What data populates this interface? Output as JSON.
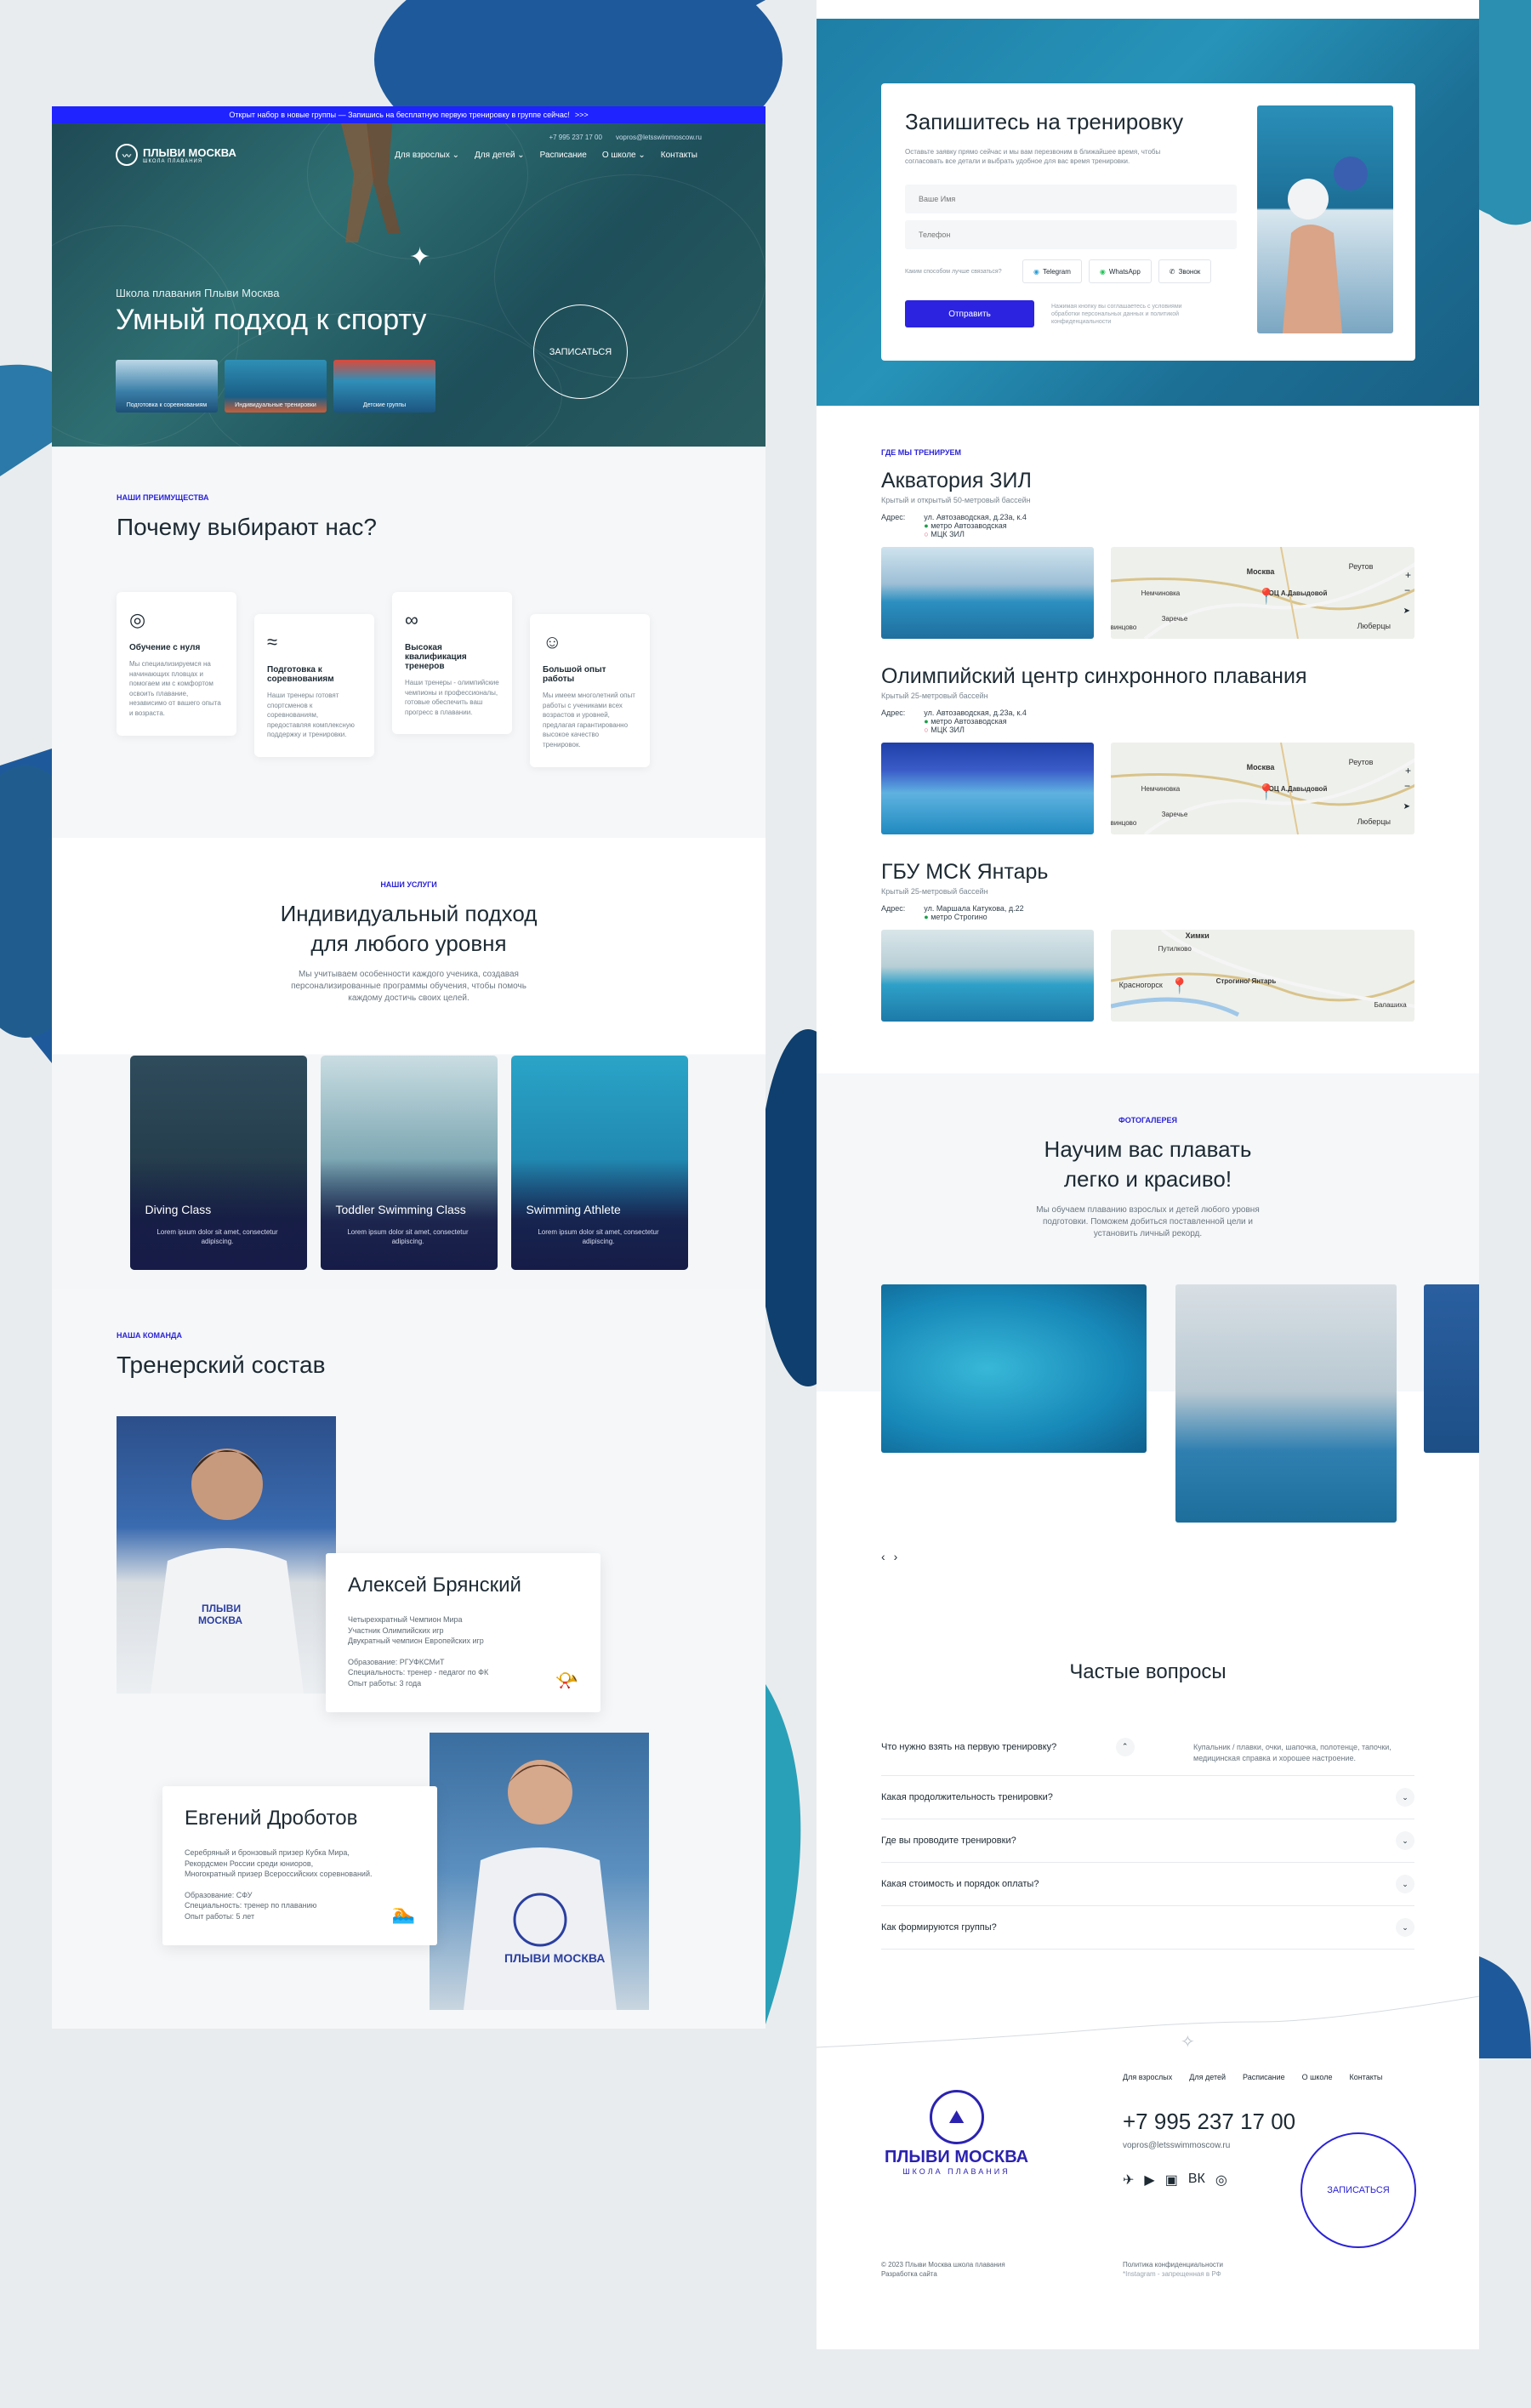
{
  "announce": {
    "text": "Открыт набор в новые группы — Запишись на бесплатную первую тренировку в группе сейчас!",
    "arrow": ">>>"
  },
  "brand": {
    "name": "ПЛЫВИ МОСКВА",
    "sub": "ШКОЛА ПЛАВАНИЯ",
    "accent": "#2b23d6"
  },
  "nav": {
    "items": [
      "Для взрослых",
      "Для детей",
      "Расписание",
      "О школе",
      "Контакты"
    ],
    "phone": "+7 995 237 17 00",
    "email": "vopros@letsswimmoscow.ru"
  },
  "hero": {
    "subtitle": "Школа плавания Плыви Москва",
    "title": "Умный подход к спорту",
    "cta": "ЗАПИСАТЬСЯ",
    "thumbs": [
      "Подготовка к соревнованиям",
      "Индивидуальные тренировки",
      "Детские группы"
    ]
  },
  "adv": {
    "eyebrow": "НАШИ ПРЕИМУЩЕСТВА",
    "title": "Почему выбирают нас?",
    "cards": [
      {
        "title": "Обучение с нуля",
        "text": "Мы специализируемся на начинающих пловцах и помогаем им с комфортом освоить плавание, независимо от вашего опыта и возраста.",
        "icon": "swim-goggles-icon"
      },
      {
        "title": "Подготовка к соревнованиям",
        "text": "Наши тренеры готовят спортсменов к соревнованиям, предоставляя комплексную поддержку и тренировки.",
        "icon": "swimmer-icon"
      },
      {
        "title": "Высокая квалификация тренеров",
        "text": "Наши тренеры - олимпийские чемпионы и профессионалы, готовые обеспечить ваш прогресс в плавании.",
        "icon": "olympic-rings-icon"
      },
      {
        "title": "Большой опыт работы",
        "text": "Мы имеем многолетний опыт работы с учениками всех возрастов и уровней, предлагая гарантированно высокое качество тренировок.",
        "icon": "team-icon"
      }
    ]
  },
  "svc": {
    "eyebrow": "НАШИ УСЛУГИ",
    "title1": "Индивидуальный подход",
    "title2": "для любого уровня",
    "desc": "Мы учитываем особенности каждого ученика, создавая персонализированные программы обучения, чтобы помочь каждому достичь своих целей.",
    "cards": [
      {
        "title": "Diving Class",
        "text": "Lorem ipsum dolor sit amet, consectetur adipiscing."
      },
      {
        "title": "Toddler Swimming Class",
        "text": "Lorem ipsum dolor sit amet, consectetur adipiscing."
      },
      {
        "title": "Swimming Athlete",
        "text": "Lorem ipsum dolor sit amet, consectetur adipiscing."
      }
    ]
  },
  "team": {
    "eyebrow": "НАША КОМАНДА",
    "title": "Тренерский состав",
    "coaches": [
      {
        "name": "Алексей Брянский",
        "l1": "Четырехкратный Чемпион Мира",
        "l2": "Участник Олимпийских игр",
        "l3": "Двукратный чемпион Европейских игр",
        "edu": "Образование: РГУФКСМиТ",
        "spec": "Специальность: тренер - педагог по ФК",
        "exp": "Опыт работы: 3 года"
      },
      {
        "name": "Евгений Дроботов",
        "l1": "Серебряный и бронзовый призер Кубка Мира,",
        "l2": "Рекордсмен России среди юниоров,",
        "l3": "Многократный призер Всероссийских соревнований.",
        "edu": "Образование: СФУ",
        "spec": "Специальность: тренер по плаванию",
        "exp": "Опыт работы: 5 лет"
      }
    ]
  },
  "signup": {
    "title": "Запишитесь на тренировку",
    "desc": "Оставьте заявку прямо сейчас и мы вам перезвоним в ближайшее время, чтобы согласовать все детали и выбрать удобное для вас время тренировки.",
    "name_ph": "Ваше Имя",
    "phone_ph": "Телефон",
    "contact_q": "Каким способом лучше связаться?",
    "telegram": "Telegram",
    "whatsapp": "WhatsApp",
    "call": "Звонок",
    "submit": "Отправить",
    "consent": "Нажимая кнопку вы соглашаетесь с условиями обработки персональных данных и политикой конфиденциальности"
  },
  "where": {
    "eyebrow": "ГДЕ МЫ ТРЕНИРУЕМ",
    "addr_label": "Адрес:",
    "locations": [
      {
        "name": "Акватория ЗИЛ",
        "sub": "Крытый и открытый 50-метровый бассейн",
        "street": "ул. Автозаводская, д.23а, к.4",
        "m1": "метро Автозаводская",
        "m2": "МЦК ЗИЛ",
        "pin": "ОЦ А.Давыдовой"
      },
      {
        "name": "Олимпийский центр синхронного плавания",
        "sub": "Крытый 25-метровый бассейн",
        "street": "ул. Автозаводская, д.23а, к.4",
        "m1": "метро Автозаводская",
        "m2": "МЦК ЗИЛ",
        "pin": "ОЦ А.Давыдовой"
      },
      {
        "name": "ГБУ МСК Янтарь",
        "sub": "Крытый 25-метровый бассейн",
        "street": "ул. Маршала Катукова, д.22",
        "m1": "метро Строгино",
        "m2": "",
        "pin": "Строгино/ Янтарь"
      }
    ],
    "map": {
      "moscow": "Москва",
      "reutov": "Реутов",
      "lyubertsy": "Люберцы",
      "zarechye": "Заречье",
      "nemchinovka": "Немчиновка",
      "khimki": "Химки",
      "putilkovo": "Путилково",
      "krasnogorsk": "Красногорск",
      "balashikha": "Балашиха",
      "vintsovo": "винцово"
    }
  },
  "gallery": {
    "eyebrow": "ФОТОГАЛЕРЕЯ",
    "title1": "Научим вас плавать",
    "title2": "легко и красиво!",
    "desc": "Мы обучаем плаванию взрослых и детей любого уровня подготовки. Поможем добиться поставленной цели и установить личный рекорд.",
    "prev": "‹",
    "next": "›"
  },
  "faq": {
    "title": "Частые вопросы",
    "items": [
      {
        "q": "Что нужно взять на первую тренировку?",
        "a": "Купальник / плавки, очки, шапочка, полотенце, тапочки, медицинская справка и хорошее настроение."
      },
      {
        "q": "Какая продолжительность тренировки?"
      },
      {
        "q": "Где вы проводите тренировки?"
      },
      {
        "q": "Какая стоимость и порядок оплаты?"
      },
      {
        "q": "Как формируются группы?"
      }
    ]
  },
  "footer": {
    "links": [
      "Для взрослых",
      "Для детей",
      "Расписание",
      "О школе",
      "Контакты"
    ],
    "phone": "+7 995 237 17 00",
    "email": "vopros@letsswimmoscow.ru",
    "cta": "ЗАПИСАТЬСЯ",
    "copy1": "© 2023 Плыви Москва школа плавания",
    "copy2": "Разработка сайта",
    "privacy": "Политика конфиденциальности",
    "insta": "*Instagram - запрещенная в РФ"
  }
}
